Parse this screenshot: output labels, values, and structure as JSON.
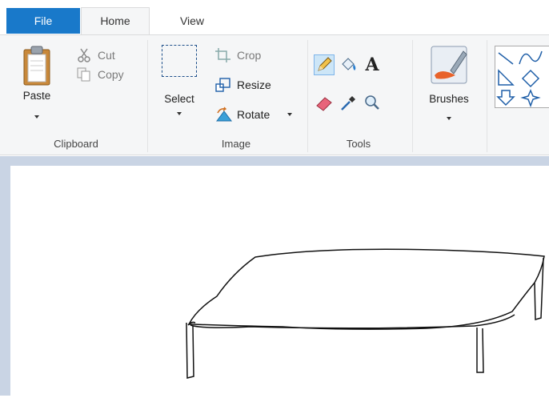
{
  "tabs": {
    "file": "File",
    "home": "Home",
    "view": "View"
  },
  "clipboard": {
    "paste": "Paste",
    "cut": "Cut",
    "copy": "Copy",
    "group": "Clipboard"
  },
  "image": {
    "select": "Select",
    "crop": "Crop",
    "resize": "Resize",
    "rotate": "Rotate",
    "group": "Image"
  },
  "tools": {
    "group": "Tools",
    "items": [
      "pencil-icon",
      "fill-icon",
      "text-icon",
      "eraser-icon",
      "color-picker-icon",
      "magnifier-icon"
    ],
    "selected": "pencil-icon"
  },
  "brushes": {
    "label": "Brushes"
  },
  "shapes": {
    "items": [
      "line-icon",
      "curve-icon",
      "right-triangle-icon",
      "diamond-icon",
      "down-arrow-icon",
      "star-icon"
    ]
  },
  "colors": {
    "tab_active": "#1979ca",
    "ribbon_bg": "#f5f6f7",
    "canvas_bg": "#c9d4e4",
    "selected_tool": "#cde6f7"
  }
}
